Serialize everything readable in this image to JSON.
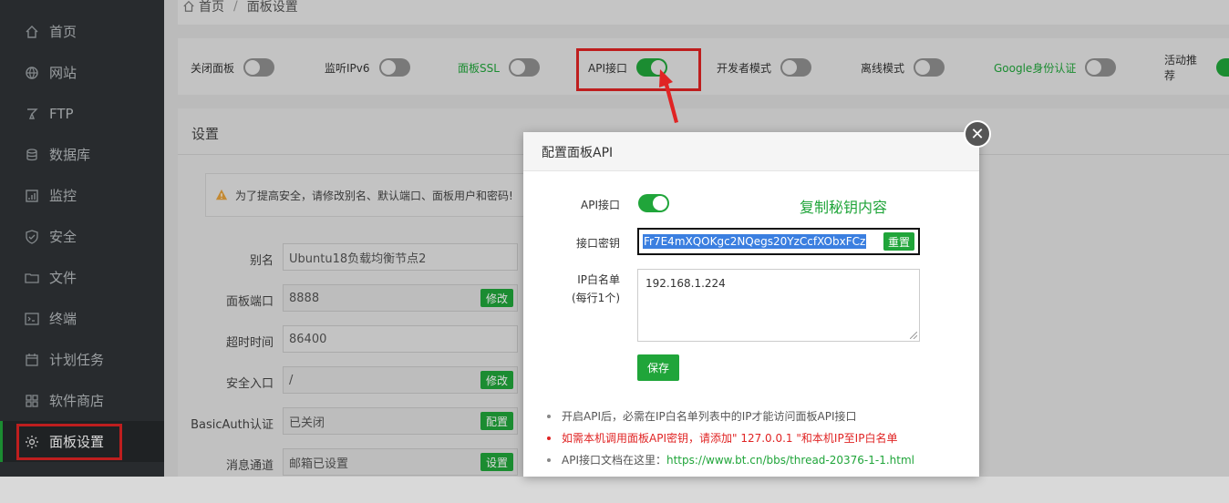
{
  "sidebar": {
    "items": [
      {
        "label": "首页",
        "icon": "home-icon"
      },
      {
        "label": "网站",
        "icon": "globe-icon"
      },
      {
        "label": "FTP",
        "icon": "ftp-icon"
      },
      {
        "label": "数据库",
        "icon": "database-icon"
      },
      {
        "label": "监控",
        "icon": "monitor-icon"
      },
      {
        "label": "安全",
        "icon": "shield-icon"
      },
      {
        "label": "文件",
        "icon": "folder-icon"
      },
      {
        "label": "终端",
        "icon": "terminal-icon"
      },
      {
        "label": "计划任务",
        "icon": "calendar-icon"
      },
      {
        "label": "软件商店",
        "icon": "apps-icon"
      },
      {
        "label": "面板设置",
        "icon": "gear-icon"
      }
    ]
  },
  "breadcrumb": {
    "home": "首页",
    "current": "面板设置"
  },
  "switches": [
    {
      "label": "关闭面板",
      "on": false
    },
    {
      "label": "监听IPv6",
      "on": false
    },
    {
      "label": "面板SSL",
      "on": false
    },
    {
      "label": "API接口",
      "on": true
    },
    {
      "label": "开发者模式",
      "on": false
    },
    {
      "label": "离线模式",
      "on": false
    },
    {
      "label": "Google身份认证",
      "on": false
    },
    {
      "label": "活动推荐",
      "on": true
    }
  ],
  "settings": {
    "title": "设置",
    "warning": "为了提高安全，请修改别名、默认端口、面板用户和密码!",
    "rows": [
      {
        "label": "别名",
        "value": "Ubuntu18负载均衡节点2",
        "button": ""
      },
      {
        "label": "面板端口",
        "value": "8888",
        "button": "修改"
      },
      {
        "label": "超时时间",
        "value": "86400",
        "button": ""
      },
      {
        "label": "安全入口",
        "value": "/",
        "button": "修改"
      },
      {
        "label": "BasicAuth认证",
        "value": "已关闭",
        "button": "配置"
      },
      {
        "label": "消息通道",
        "value": "邮箱已设置",
        "button": "设置"
      }
    ]
  },
  "modal": {
    "title": "配置面板API",
    "api_label": "API接口",
    "api_on": true,
    "copy_hint": "复制秘钥内容",
    "key_label": "接口密钥",
    "key_value": "Fr7E4mXQOKgc2NQegs20YzCcfXObxFCz",
    "reset_label": "重置",
    "ip_label_1": "IP白名单",
    "ip_label_2": "(每行1个)",
    "ip_value": "192.168.1.224",
    "save_label": "保存",
    "notes": {
      "n1": "开启API后，必需在IP白名单列表中的IP才能访问面板API接口",
      "n2": "如需本机调用面板API密钥，请添加\" 127.0.0.1 \"和本机IP至IP白名单",
      "n3_prefix": "API接口文档在这里：",
      "n3_link": "https://www.bt.cn/bbs/thread-20376-1-1.html"
    },
    "close_glyph": "✕"
  },
  "colors": {
    "accent": "#20a53a",
    "highlight": "#e02424",
    "sidebar": "#2f3337"
  }
}
